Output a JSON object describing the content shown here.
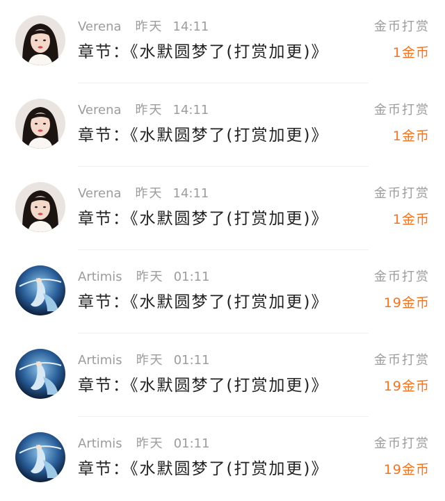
{
  "items": [
    {
      "user": "Verena",
      "day": "昨天",
      "time": "14:11",
      "chapter": "章节：《水默圆梦了(打赏加更)》",
      "action": "金币打赏",
      "amount": "1金币",
      "avatar": "girl-avatar"
    },
    {
      "user": "Verena",
      "day": "昨天",
      "time": "14:11",
      "chapter": "章节：《水默圆梦了(打赏加更)》",
      "action": "金币打赏",
      "amount": "1金币",
      "avatar": "girl-avatar"
    },
    {
      "user": "Verena",
      "day": "昨天",
      "time": "14:11",
      "chapter": "章节：《水默圆梦了(打赏加更)》",
      "action": "金币打赏",
      "amount": "1金币",
      "avatar": "girl-avatar"
    },
    {
      "user": "Artimis",
      "day": "昨天",
      "time": "01:11",
      "chapter": "章节：《水默圆梦了(打赏加更)》",
      "action": "金币打赏",
      "amount": "19金币",
      "avatar": "goddess-avatar"
    },
    {
      "user": "Artimis",
      "day": "昨天",
      "time": "01:11",
      "chapter": "章节：《水默圆梦了(打赏加更)》",
      "action": "金币打赏",
      "amount": "19金币",
      "avatar": "goddess-avatar"
    },
    {
      "user": "Artimis",
      "day": "昨天",
      "time": "01:11",
      "chapter": "章节：《水默圆梦了(打赏加更)》",
      "action": "金币打赏",
      "amount": "19金币",
      "avatar": "goddess-avatar"
    }
  ],
  "colors": {
    "amount": "#f0731f",
    "meta": "#9c9c9c",
    "text": "#222222"
  }
}
